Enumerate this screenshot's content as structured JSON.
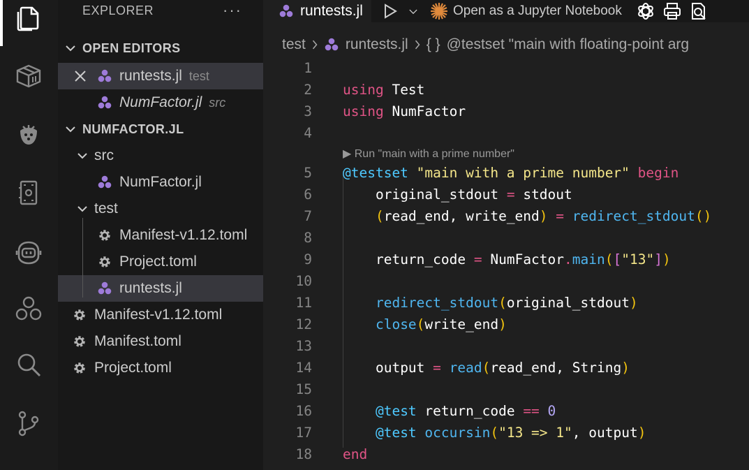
{
  "explorer": {
    "title": "EXPLORER",
    "more": "···",
    "open_editors_label": "OPEN EDITORS",
    "open_editors": [
      {
        "name": "runtests.jl",
        "desc": "test"
      },
      {
        "name": "NumFactor.jl",
        "desc": "src"
      }
    ],
    "project_label": "NUMFACTOR.JL",
    "tree": {
      "src_folder": "src",
      "src_file": "NumFactor.jl",
      "test_folder": "test",
      "test_files": [
        "Manifest-v1.12.toml",
        "Project.toml",
        "runtests.jl"
      ],
      "root_files": [
        "Manifest-v1.12.toml",
        "Manifest.toml",
        "Project.toml"
      ]
    }
  },
  "tab": {
    "label": "runtests.jl"
  },
  "toolbar": {
    "jupyter_label": "Open as a Jupyter Notebook"
  },
  "breadcrumb": {
    "folder": "test",
    "file": "runtests.jl",
    "symbol_prefix": "{ }",
    "symbol": "@testset \"main with floating-point arg"
  },
  "code": {
    "line_numbers": [
      "1",
      "2",
      "3",
      "4",
      "5",
      "6",
      "7",
      "8",
      "9",
      "10",
      "11",
      "12",
      "13",
      "14",
      "15",
      "16",
      "17",
      "18"
    ],
    "codelens": "▶ Run \"main with a prime number\"",
    "l2_kw": "using",
    "l2_mod": "Test",
    "l3_kw": "using",
    "l3_mod": "NumFactor",
    "l5_mac": "@testset",
    "l5_str": "\"main with a prime number\"",
    "l5_kw": "begin",
    "l6_a": "original_stdout",
    "l6_op": "=",
    "l6_b": "stdout",
    "l7_open": "(",
    "l7_a": "read_end, write_end",
    "l7_close": ")",
    "l7_op": "=",
    "l7_fn": "redirect_stdout",
    "l7_p": "()",
    "l9_a": "return_code",
    "l9_op": "=",
    "l9_mod": "NumFactor",
    "l9_dot": ".",
    "l9_fn": "main",
    "l9_p1": "(",
    "l9_p2": "[",
    "l9_str": "\"13\"",
    "l9_p2c": "]",
    "l9_p1c": ")",
    "l11_fn": "redirect_stdout",
    "l11_p": "(",
    "l11_arg": "original_stdout",
    "l11_pc": ")",
    "l12_fn": "close",
    "l12_p": "(",
    "l12_arg": "write_end",
    "l12_pc": ")",
    "l14_a": "output",
    "l14_op": "=",
    "l14_fn": "read",
    "l14_p": "(",
    "l14_arg": "read_end, String",
    "l14_pc": ")",
    "l16_mac": "@test",
    "l16_a": "return_code",
    "l16_op": "==",
    "l16_num": "0",
    "l17_mac": "@test",
    "l17_fn": "occursin",
    "l17_p": "(",
    "l17_str": "\"13 => 1\"",
    "l17_rest": ", output",
    "l17_pc": ")",
    "l18_kw": "end"
  },
  "colors": {
    "julia_purple": "#9558b2",
    "keyword": "#e05486",
    "macro": "#4ec9ff",
    "string": "#f5e78a"
  }
}
